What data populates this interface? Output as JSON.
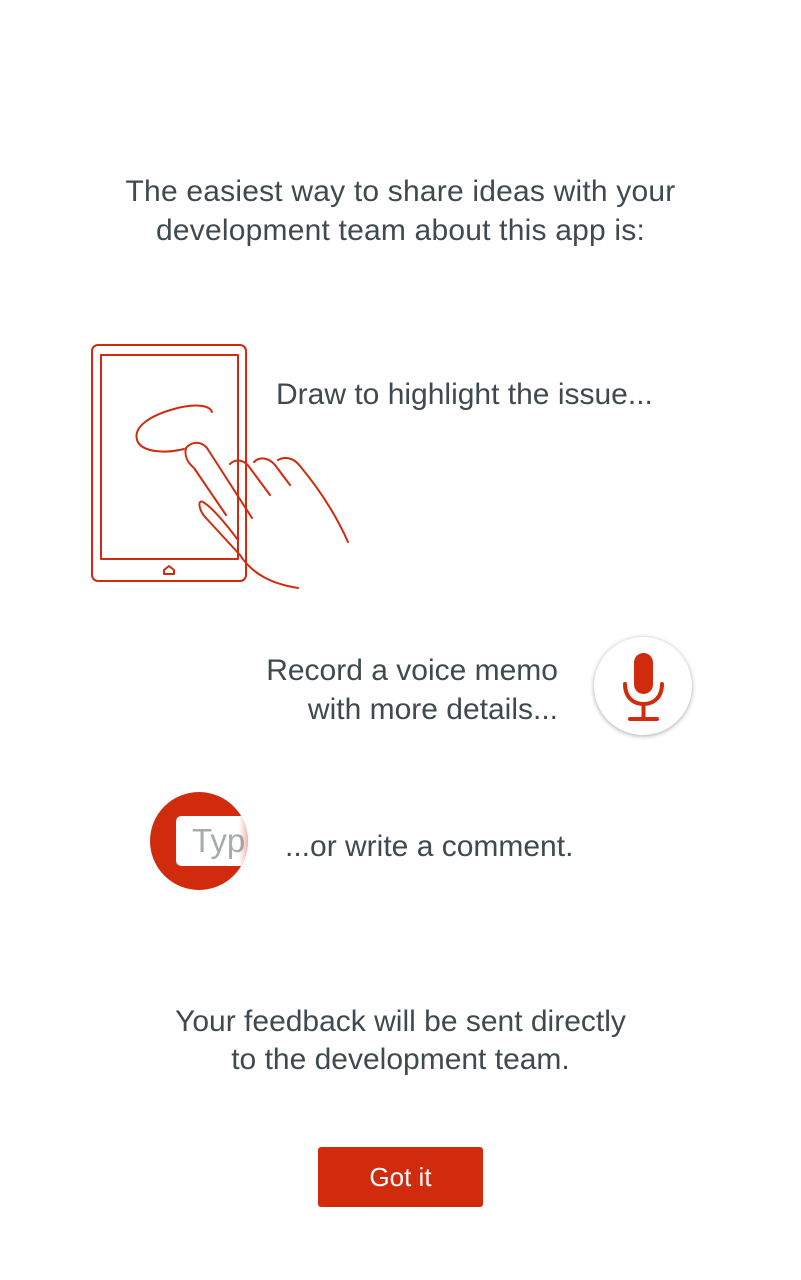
{
  "intro": {
    "line1": "The easiest way to share ideas with your",
    "line2": "development team about this app is:"
  },
  "draw": {
    "text": "Draw to highlight the issue...",
    "icon": "tablet-hand-drawing-illustration"
  },
  "record": {
    "line1": "Record a voice memo",
    "line2": "with more details...",
    "icon": "microphone-icon"
  },
  "comment": {
    "placeholder": "Typ",
    "text": "...or write a comment.",
    "icon": "text-field-icon"
  },
  "footer": {
    "line1": "Your feedback will be sent directly",
    "line2": "to the development team."
  },
  "button": {
    "label": "Got it"
  },
  "colors": {
    "accent": "#d12b0e",
    "text": "#3f4a4f",
    "background": "#ffffff",
    "placeholder": "#a4acb0"
  }
}
